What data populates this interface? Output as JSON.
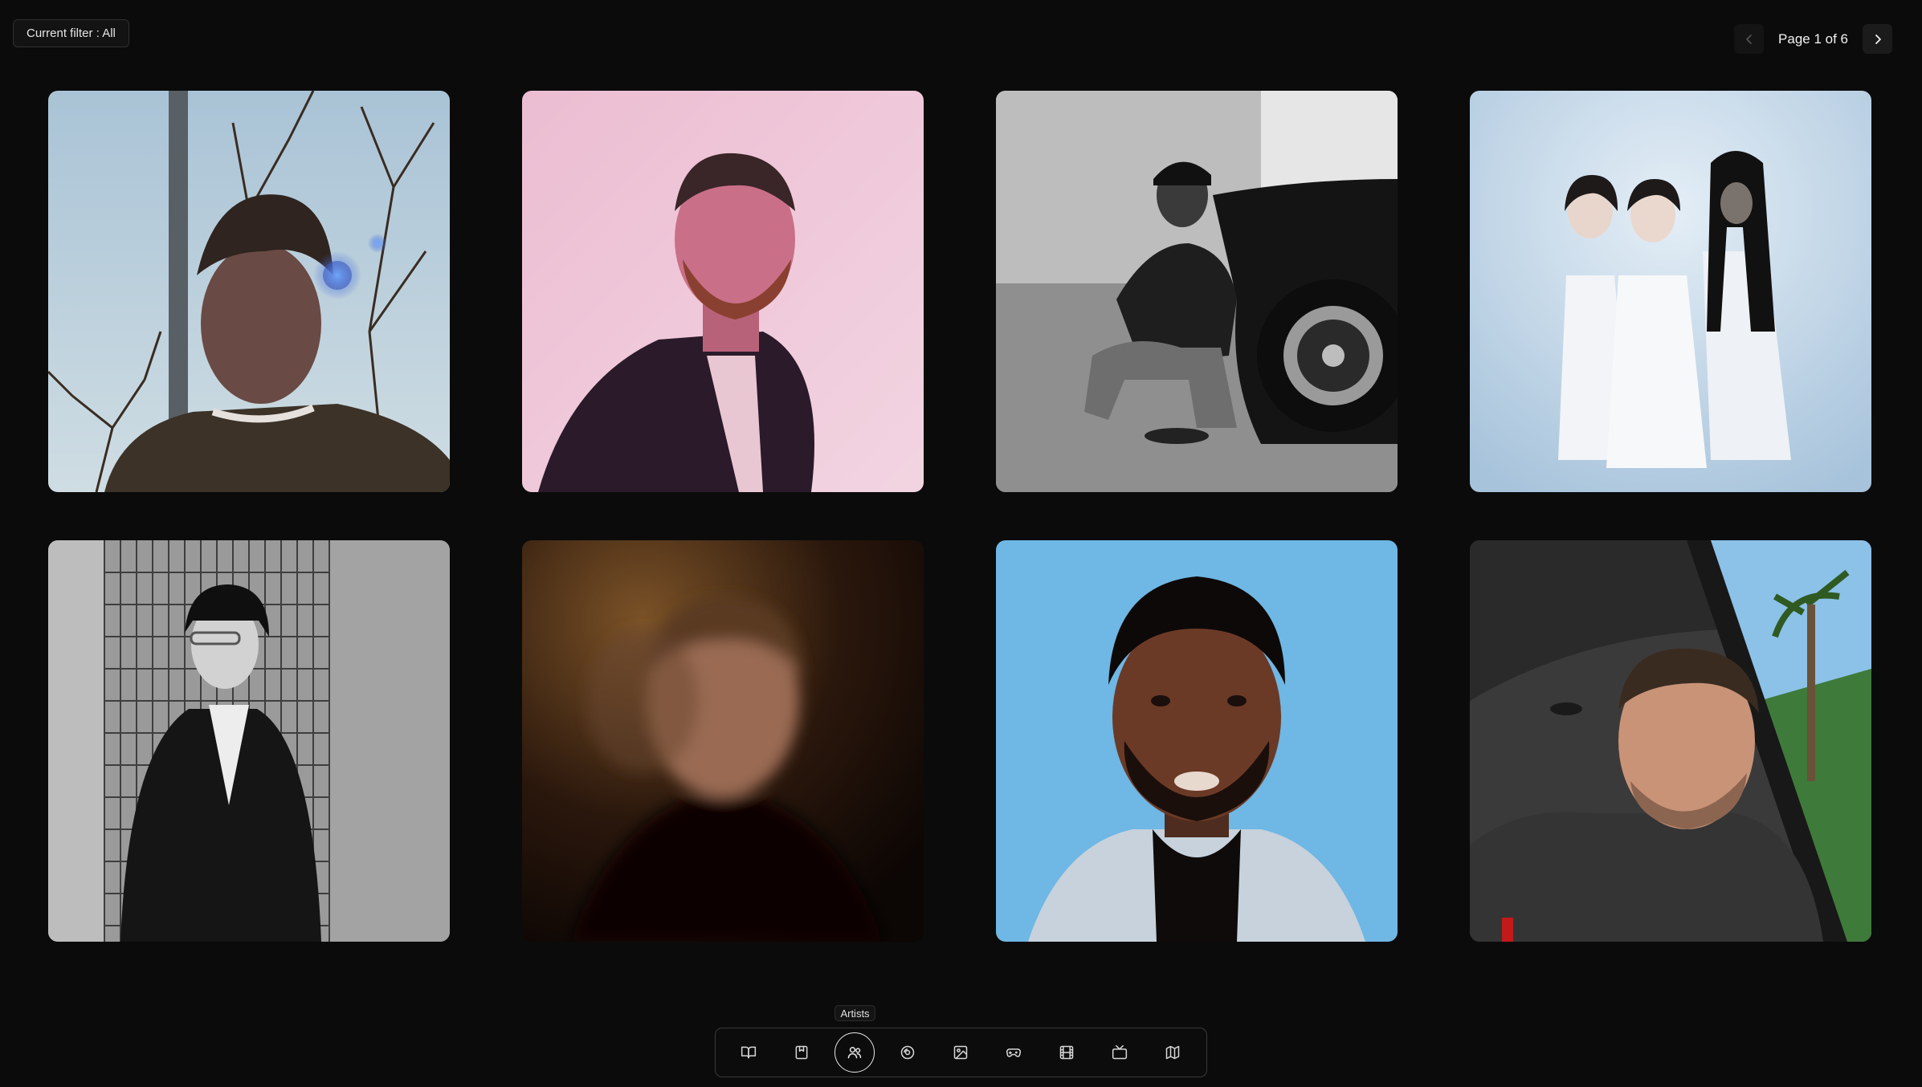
{
  "filter": {
    "label": "Current filter : All"
  },
  "pagination": {
    "label": "Page 1 of 6",
    "current": 1,
    "total": 6,
    "prev_icon": "chevron-left-icon",
    "next_icon": "chevron-right-icon"
  },
  "tooltip": {
    "text": "Artists"
  },
  "dock": {
    "active": "artists",
    "items": [
      {
        "id": "books",
        "icon": "book-open-icon"
      },
      {
        "id": "bookmarks",
        "icon": "bookmark-icon"
      },
      {
        "id": "artists",
        "icon": "users-icon"
      },
      {
        "id": "music",
        "icon": "vinyl-icon"
      },
      {
        "id": "images",
        "icon": "image-icon"
      },
      {
        "id": "games",
        "icon": "gamepad-icon"
      },
      {
        "id": "films",
        "icon": "film-icon"
      },
      {
        "id": "tv",
        "icon": "tv-icon"
      },
      {
        "id": "maps",
        "icon": "map-icon"
      }
    ]
  },
  "colors": {
    "background": "#0b0b0b",
    "accent": "#e8e8e8"
  }
}
